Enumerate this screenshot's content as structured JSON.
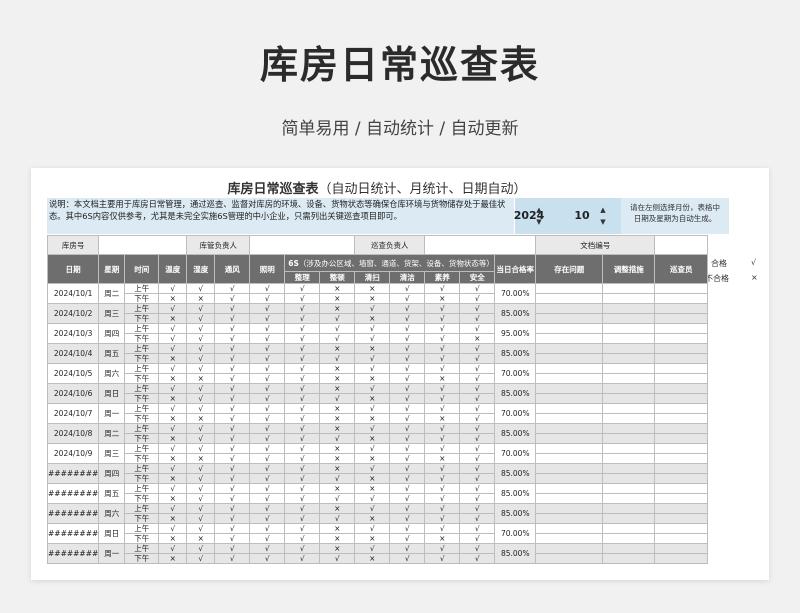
{
  "hero": {
    "title": "库房日常巡查表",
    "subtitle": "简单易用  /  自动统计  /  自动更新"
  },
  "sheet": {
    "title_main": "库房日常巡查表",
    "title_note": "（自动日统计、月统计、日期自动）",
    "description": "说明：本文档主要用于库房日常管理，通过巡查、监督对库房的环境、设备、货物状态等确保仓库环境与货物储存处于最佳状态。其中6S内容仅供参考，尤其是未完全实施6S管理的中小企业，只需列出关键巡查项目即可。",
    "year": "2024",
    "month": "10",
    "spin_up": "▲",
    "spin_down": "▼",
    "hint": "请在左侧选择月份，表格中日期及星期为自动生成。"
  },
  "legend": {
    "pass_label": "合格",
    "pass_symbol": "√",
    "fail_label": "不合格",
    "fail_symbol": "×"
  },
  "info_row": {
    "warehouse_label": "库房号",
    "manager_label": "库管负责人",
    "inspector_label": "巡查负责人",
    "doc_label": "文档编号"
  },
  "headers": {
    "date": "日期",
    "weekday": "星期",
    "time": "时间",
    "temperature": "温度",
    "humidity": "湿度",
    "ventilation": "通风",
    "lighting": "照明",
    "sixs_title": "6S",
    "sixs_note": "（涉及办公区域、墙窗、通道、货架、设备、货物状态等）",
    "sixs_items": [
      "整理",
      "整顿",
      "清扫",
      "清洁",
      "素养",
      "安全"
    ],
    "daily_rate": "当日合格率",
    "issues": "存在问题",
    "measures": "调整措施",
    "inspector": "巡查员"
  },
  "time_labels": [
    "上午",
    "下午"
  ],
  "rows": [
    {
      "date": "2024/10/1",
      "weekday": "周二",
      "rate": "70.00%",
      "am": [
        "√",
        "√",
        "√",
        "√",
        "√",
        "×",
        "×",
        "√",
        "√",
        "√"
      ],
      "pm": [
        "×",
        "×",
        "√",
        "√",
        "√",
        "×",
        "×",
        "√",
        "×",
        "√"
      ]
    },
    {
      "date": "2024/10/2",
      "weekday": "周三",
      "rate": "85.00%",
      "am": [
        "√",
        "√",
        "√",
        "√",
        "√",
        "×",
        "√",
        "√",
        "√",
        "√"
      ],
      "pm": [
        "×",
        "√",
        "√",
        "√",
        "√",
        "√",
        "×",
        "√",
        "√",
        "√"
      ]
    },
    {
      "date": "2024/10/3",
      "weekday": "周四",
      "rate": "95.00%",
      "am": [
        "√",
        "√",
        "√",
        "√",
        "√",
        "√",
        "√",
        "√",
        "√",
        "√"
      ],
      "pm": [
        "√",
        "√",
        "√",
        "√",
        "√",
        "√",
        "√",
        "√",
        "√",
        "×"
      ]
    },
    {
      "date": "2024/10/4",
      "weekday": "周五",
      "rate": "85.00%",
      "am": [
        "√",
        "√",
        "√",
        "√",
        "√",
        "×",
        "×",
        "√",
        "√",
        "√"
      ],
      "pm": [
        "×",
        "√",
        "√",
        "√",
        "√",
        "√",
        "√",
        "√",
        "√",
        "√"
      ]
    },
    {
      "date": "2024/10/5",
      "weekday": "周六",
      "rate": "70.00%",
      "am": [
        "√",
        "√",
        "√",
        "√",
        "√",
        "×",
        "√",
        "√",
        "√",
        "√"
      ],
      "pm": [
        "×",
        "×",
        "√",
        "√",
        "√",
        "×",
        "×",
        "√",
        "×",
        "√"
      ]
    },
    {
      "date": "2024/10/6",
      "weekday": "周日",
      "rate": "85.00%",
      "am": [
        "√",
        "√",
        "√",
        "√",
        "√",
        "×",
        "√",
        "√",
        "√",
        "√"
      ],
      "pm": [
        "×",
        "√",
        "√",
        "√",
        "√",
        "√",
        "×",
        "√",
        "√",
        "√"
      ]
    },
    {
      "date": "2024/10/7",
      "weekday": "周一",
      "rate": "70.00%",
      "am": [
        "√",
        "√",
        "√",
        "√",
        "√",
        "×",
        "√",
        "√",
        "√",
        "√"
      ],
      "pm": [
        "×",
        "×",
        "√",
        "√",
        "√",
        "×",
        "×",
        "√",
        "×",
        "√"
      ]
    },
    {
      "date": "2024/10/8",
      "weekday": "周二",
      "rate": "85.00%",
      "am": [
        "√",
        "√",
        "√",
        "√",
        "√",
        "×",
        "√",
        "√",
        "√",
        "√"
      ],
      "pm": [
        "×",
        "√",
        "√",
        "√",
        "√",
        "√",
        "×",
        "√",
        "√",
        "√"
      ]
    },
    {
      "date": "2024/10/9",
      "weekday": "周三",
      "rate": "70.00%",
      "am": [
        "√",
        "√",
        "√",
        "√",
        "√",
        "×",
        "√",
        "√",
        "√",
        "√"
      ],
      "pm": [
        "×",
        "×",
        "√",
        "√",
        "√",
        "×",
        "×",
        "√",
        "×",
        "√"
      ]
    },
    {
      "date": "########",
      "weekday": "周四",
      "rate": "85.00%",
      "am": [
        "√",
        "√",
        "√",
        "√",
        "√",
        "×",
        "√",
        "√",
        "√",
        "√"
      ],
      "pm": [
        "×",
        "√",
        "√",
        "√",
        "√",
        "√",
        "×",
        "√",
        "√",
        "√"
      ]
    },
    {
      "date": "########",
      "weekday": "周五",
      "rate": "85.00%",
      "am": [
        "√",
        "√",
        "√",
        "√",
        "√",
        "×",
        "×",
        "√",
        "√",
        "√"
      ],
      "pm": [
        "×",
        "√",
        "√",
        "√",
        "√",
        "√",
        "√",
        "√",
        "√",
        "√"
      ]
    },
    {
      "date": "########",
      "weekday": "周六",
      "rate": "85.00%",
      "am": [
        "√",
        "√",
        "√",
        "√",
        "√",
        "×",
        "√",
        "√",
        "√",
        "√"
      ],
      "pm": [
        "×",
        "√",
        "√",
        "√",
        "√",
        "√",
        "×",
        "√",
        "√",
        "√"
      ]
    },
    {
      "date": "########",
      "weekday": "周日",
      "rate": "70.00%",
      "am": [
        "√",
        "√",
        "√",
        "√",
        "√",
        "×",
        "√",
        "√",
        "√",
        "√"
      ],
      "pm": [
        "×",
        "×",
        "√",
        "√",
        "√",
        "×",
        "×",
        "√",
        "×",
        "√"
      ]
    },
    {
      "date": "########",
      "weekday": "周一",
      "rate": "85.00%",
      "am": [
        "√",
        "√",
        "√",
        "√",
        "√",
        "×",
        "√",
        "√",
        "√",
        "√"
      ],
      "pm": [
        "×",
        "√",
        "√",
        "√",
        "√",
        "√",
        "×",
        "√",
        "√",
        "√"
      ]
    }
  ]
}
